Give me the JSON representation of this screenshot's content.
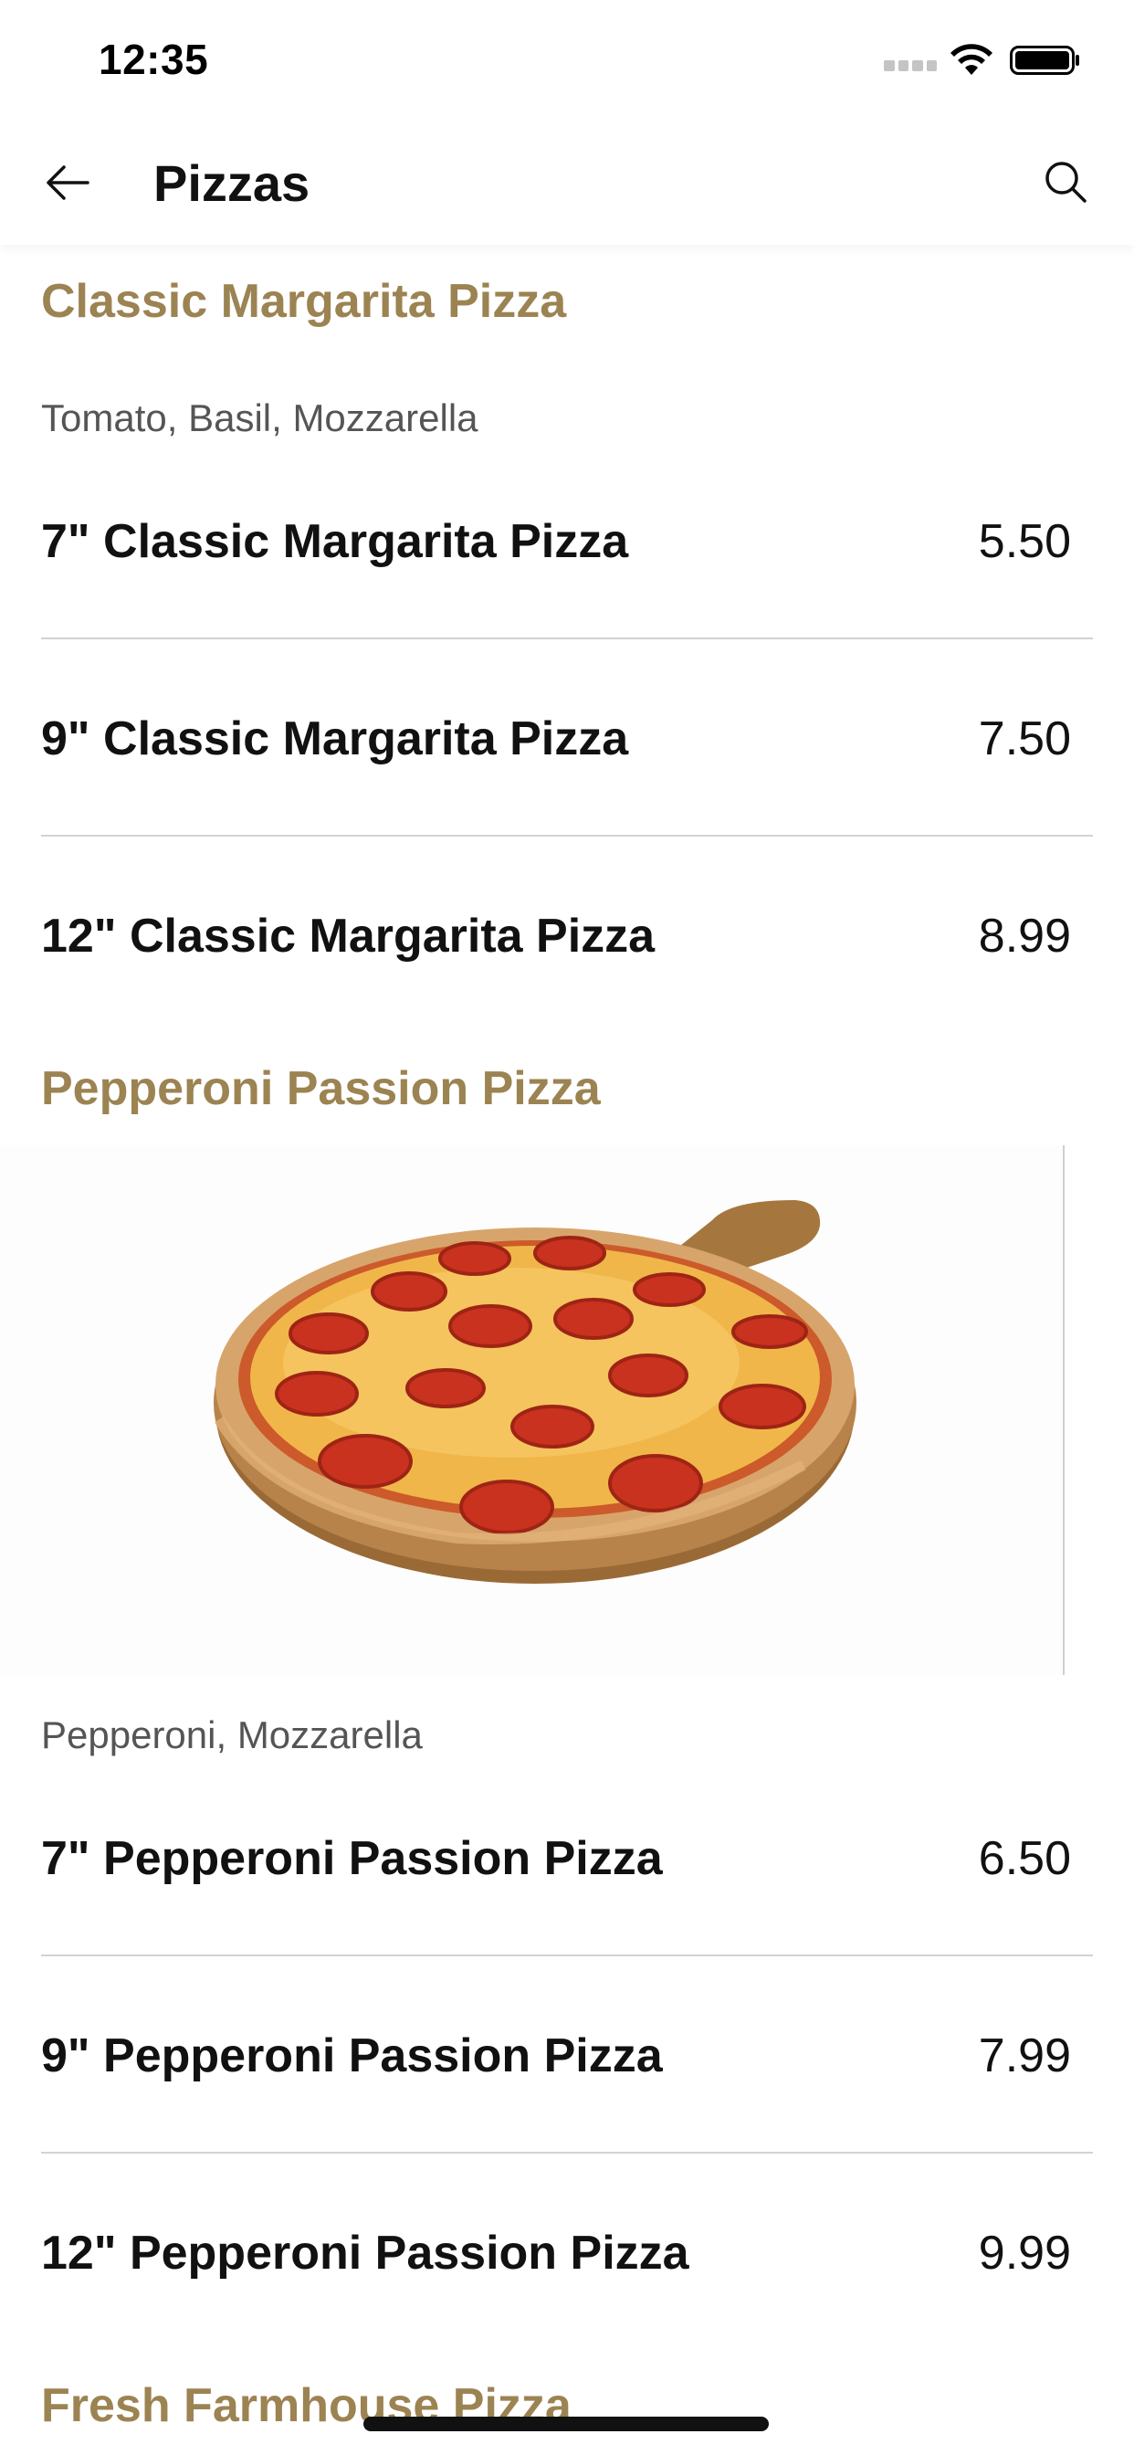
{
  "status_bar": {
    "time": "12:35",
    "icons": [
      "signal-icon",
      "wifi-icon",
      "battery-icon"
    ]
  },
  "nav": {
    "title": "Pizzas",
    "back_icon": "arrow-left-icon",
    "search_icon": "search-icon"
  },
  "colors": {
    "section_title": "#9c8352",
    "description": "#555555",
    "divider": "#d3d3d3",
    "text": "#111111"
  },
  "sections": [
    {
      "title": "Classic Margarita Pizza",
      "description": "Tomato, Basil, Mozzarella",
      "items": [
        {
          "name": "7\" Classic Margarita Pizza",
          "price": "5.50"
        },
        {
          "name": "9\" Classic Margarita Pizza",
          "price": "7.50"
        },
        {
          "name": "12\" Classic Margarita Pizza",
          "price": "8.99"
        }
      ]
    },
    {
      "title": "Pepperoni Passion Pizza",
      "image": "pepperoni-pizza-on-wooden-board",
      "description": "Pepperoni, Mozzarella",
      "items": [
        {
          "name": "7\" Pepperoni Passion Pizza",
          "price": "6.50"
        },
        {
          "name": "9\" Pepperoni Passion Pizza",
          "price": "7.99"
        },
        {
          "name": "12\" Pepperoni Passion Pizza",
          "price": "9.99"
        }
      ]
    },
    {
      "title": "Fresh Farmhouse Pizza"
    }
  ]
}
